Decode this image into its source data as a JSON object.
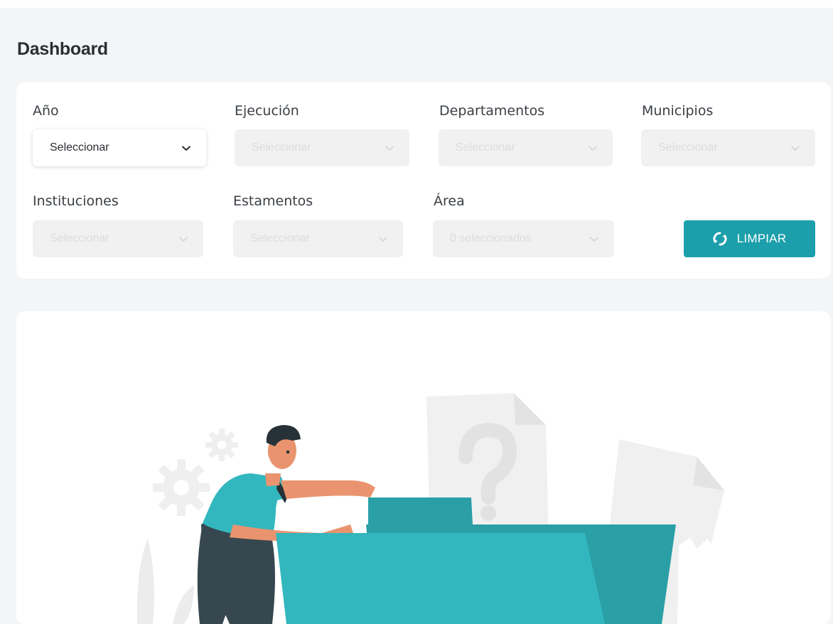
{
  "header": {
    "title": "Dashboard"
  },
  "filters": {
    "anio": {
      "label": "Año",
      "value": "Seleccionar"
    },
    "ejecucion": {
      "label": "Ejecución",
      "placeholder": "Seleccionar"
    },
    "departamentos": {
      "label": "Departamentos",
      "placeholder": "Seleccionar"
    },
    "municipios": {
      "label": "Municipios",
      "placeholder": "Seleccionar"
    },
    "instituciones": {
      "label": "Instituciones",
      "placeholder": "Seleccionar"
    },
    "estamentos": {
      "label": "Estamentos",
      "placeholder": "Seleccionar"
    },
    "area": {
      "label": "Área",
      "value": "0 seleccionados"
    }
  },
  "actions": {
    "clear_label": "LIMPIAR"
  },
  "colors": {
    "accent": "#1c9fab",
    "folder": "#33b7be",
    "folder_dark": "#2a9fa6",
    "background": "#f4f5f7"
  },
  "icons": {
    "dropdown": "chevron-down-icon",
    "clear": "refresh-icon"
  },
  "illustration": {
    "name": "empty-state-illustration"
  }
}
